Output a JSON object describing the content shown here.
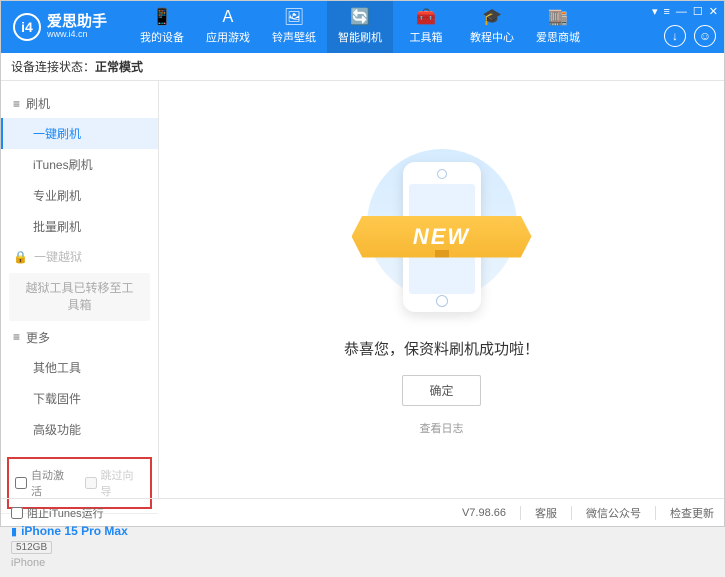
{
  "app": {
    "title": "爱思助手",
    "url": "www.i4.cn"
  },
  "nav": {
    "items": [
      {
        "label": "我的设备",
        "icon": "📱"
      },
      {
        "label": "应用游戏",
        "icon": "Ａ"
      },
      {
        "label": "铃声壁纸",
        "icon": "🖼"
      },
      {
        "label": "智能刷机",
        "icon": "🔄"
      },
      {
        "label": "工具箱",
        "icon": "🧰"
      },
      {
        "label": "教程中心",
        "icon": "🎓"
      },
      {
        "label": "爱思商城",
        "icon": "🏬"
      }
    ],
    "active_index": 3
  },
  "status": {
    "label": "设备连接状态：",
    "value": "正常模式"
  },
  "sidebar": {
    "flash_header": "刷机",
    "flash_icon": "≡",
    "flash_items": [
      "一键刷机",
      "iTunes刷机",
      "专业刷机",
      "批量刷机"
    ],
    "flash_active_index": 0,
    "jailbreak_header": "一键越狱",
    "jailbreak_icon": "🔒",
    "jailbreak_note": "越狱工具已转移至工具箱",
    "more_header": "更多",
    "more_icon": "≡",
    "more_items": [
      "其他工具",
      "下载固件",
      "高级功能"
    ],
    "checkbox1": "自动激活",
    "checkbox2": "跳过向导"
  },
  "device": {
    "name": "iPhone 15 Pro Max",
    "storage": "512GB",
    "type": "iPhone"
  },
  "main": {
    "ribbon": "NEW",
    "message": "恭喜您，保资料刷机成功啦！",
    "ok": "确定",
    "log_link": "查看日志"
  },
  "bottom": {
    "block_itunes": "阻止iTunes运行",
    "version": "V7.98.66",
    "links": [
      "客服",
      "微信公众号",
      "检查更新"
    ]
  }
}
